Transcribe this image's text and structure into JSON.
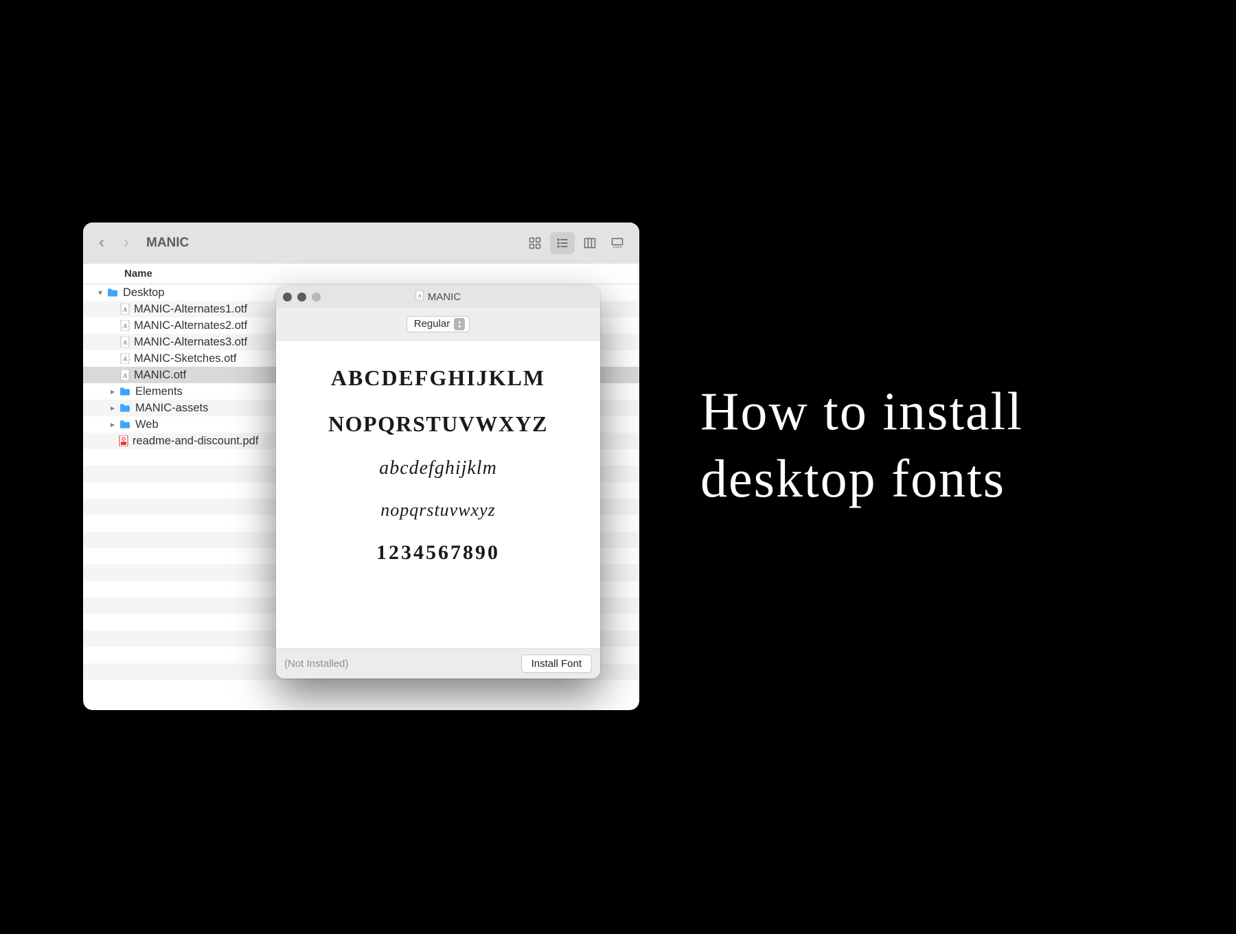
{
  "finder": {
    "title": "MANIC",
    "column_header": "Name",
    "tree": {
      "root": {
        "label": "Desktop"
      },
      "files": [
        "MANIC-Alternates1.otf",
        "MANIC-Alternates2.otf",
        "MANIC-Alternates3.otf",
        "MANIC-Sketches.otf",
        "MANIC.otf"
      ],
      "folders": [
        "Elements",
        "MANIC-assets",
        "Web"
      ],
      "pdf": "readme-and-discount.pdf",
      "selected": "MANIC.otf"
    }
  },
  "fontbook": {
    "title": "MANIC",
    "style": "Regular",
    "samples": [
      "ABCDEFGHIJKLM",
      "NOPQRSTUVWXYZ",
      "abcdefghijklm",
      "nopqrstuvwxyz",
      "1234567890"
    ],
    "status": "(Not Installed)",
    "install_label": "Install Font"
  },
  "heading": {
    "line1": "How to install",
    "line2": "desktop fonts"
  }
}
